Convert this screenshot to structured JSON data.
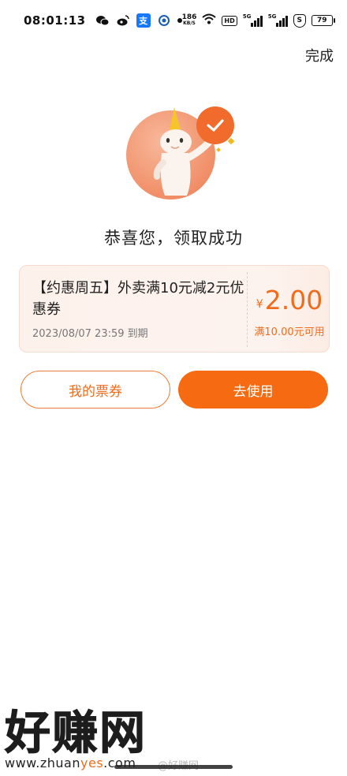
{
  "status": {
    "time": "08:01:13",
    "left_icons": [
      "wechat-icon",
      "weibo-icon",
      "alipay-icon",
      "app-icon",
      "dot-icon"
    ],
    "alipay_glyph": "支",
    "net_speed": "186",
    "net_unit": "KB/S",
    "hd": "HD",
    "sig1_label": "5G",
    "sig2_label": "5G",
    "shield": "S",
    "battery": "79"
  },
  "header": {
    "done_label": "完成"
  },
  "result": {
    "title": "恭喜您，领取成功"
  },
  "coupon": {
    "title": "【约惠周五】外卖满10元减2元优惠券",
    "expiry": "2023/08/07 23:59 到期",
    "currency": "¥",
    "amount": "2.00",
    "condition": "满10.00元可用"
  },
  "actions": {
    "my_tickets_label": "我的票券",
    "use_label": "去使用"
  },
  "colors": {
    "accent": "#f66a12",
    "accent_text": "#f06b1b",
    "coupon_bg": "#fdf1ec"
  },
  "watermark": {
    "big": "好赚网",
    "url_prefix": "www.zhuan",
    "url_highlight": "yes",
    "url_suffix": ".com",
    "handle": "@好赚网"
  }
}
